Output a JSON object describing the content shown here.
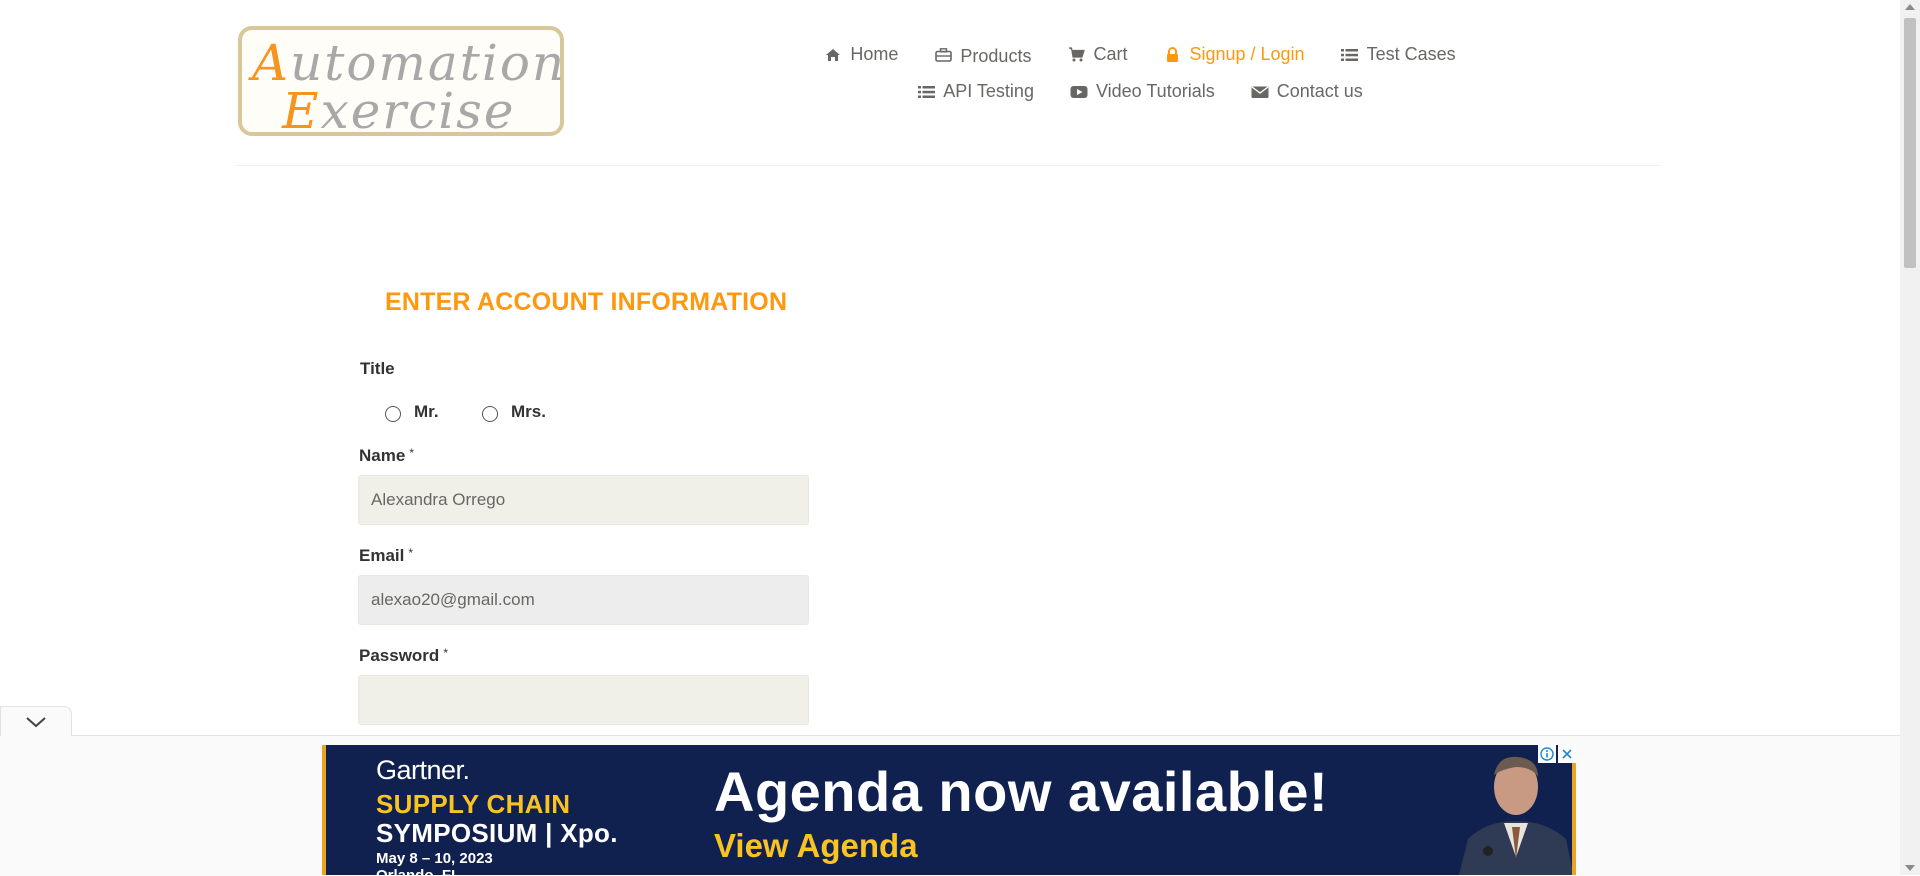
{
  "logo": {
    "line1_cap": "A",
    "line1_rest": "utomation",
    "line2_cap": "E",
    "line2_rest": "xercise"
  },
  "nav": {
    "items": [
      {
        "label": "Home",
        "icon": "home-icon"
      },
      {
        "label": "Products",
        "icon": "products-icon"
      },
      {
        "label": "Cart",
        "icon": "cart-icon"
      },
      {
        "label": "Signup / Login",
        "icon": "lock-icon",
        "active": true
      },
      {
        "label": "Test Cases",
        "icon": "list-icon"
      },
      {
        "label": "API Testing",
        "icon": "list-icon"
      },
      {
        "label": "Video Tutorials",
        "icon": "youtube-icon"
      },
      {
        "label": "Contact us",
        "icon": "envelope-icon"
      }
    ],
    "active_color": "#fe980f"
  },
  "form": {
    "heading": "ENTER ACCOUNT INFORMATION",
    "title_label": "Title",
    "title_options": [
      "Mr.",
      "Mrs."
    ],
    "name": {
      "label": "Name",
      "required": "*",
      "value": "Alexandra Orrego"
    },
    "email": {
      "label": "Email",
      "required": "*",
      "value": "alexao20@gmail.com"
    },
    "password": {
      "label": "Password",
      "required": "*",
      "value": ""
    }
  },
  "ad": {
    "brand": "Gartner.",
    "event_line1": "SUPPLY CHAIN",
    "event_line2": "SYMPOSIUM | Xpo.",
    "dates": "May 8 – 10, 2023",
    "location": "Orlando, FL",
    "headline": "Agenda now available!",
    "cta": "View Agenda",
    "info_icon": "info-icon",
    "close_icon": "close-icon"
  },
  "colors": {
    "accent": "#fe980f",
    "ad_bg": "#102150",
    "ad_yellow": "#f9c322"
  }
}
